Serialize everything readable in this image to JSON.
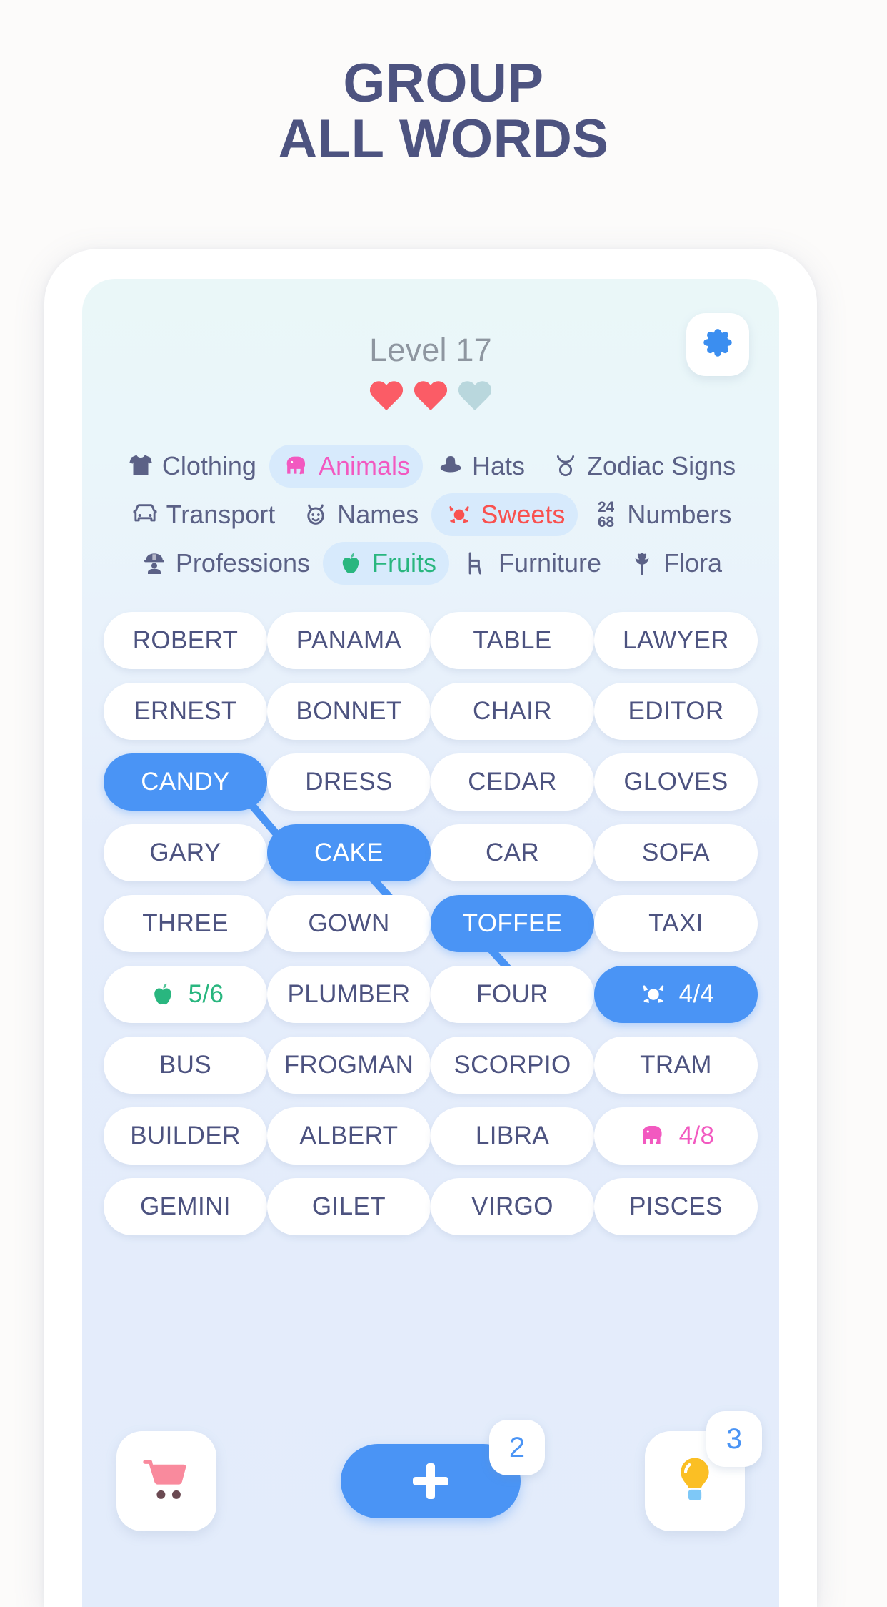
{
  "headline": {
    "line1": "GROUP",
    "line2": "ALL WORDS"
  },
  "header": {
    "level_label": "Level 17",
    "lives_total": 3,
    "lives_remaining": 2,
    "settings_icon": "gear-icon"
  },
  "categories": [
    [
      {
        "label": "Clothing",
        "icon": "tshirt-icon",
        "active": false,
        "color": "#5b6186"
      },
      {
        "label": "Animals",
        "icon": "elephant-icon",
        "active": true,
        "color": "#f259c0"
      },
      {
        "label": "Hats",
        "icon": "hat-icon",
        "active": false,
        "color": "#5b6186"
      },
      {
        "label": "Zodiac Signs",
        "icon": "taurus-icon",
        "active": false,
        "color": "#5b6186"
      }
    ],
    [
      {
        "label": "Transport",
        "icon": "car-icon",
        "active": false,
        "color": "#5b6186"
      },
      {
        "label": "Names",
        "icon": "face-icon",
        "active": false,
        "color": "#5b6186"
      },
      {
        "label": "Sweets",
        "icon": "candy-icon",
        "active": true,
        "color": "#f9514f"
      },
      {
        "label": "Numbers",
        "icon": "numbers-icon",
        "active": false,
        "color": "#5b6186",
        "icon_text_top": "24",
        "icon_text_bottom": "68"
      }
    ],
    [
      {
        "label": "Professions",
        "icon": "worker-icon",
        "active": false,
        "color": "#5b6186"
      },
      {
        "label": "Fruits",
        "icon": "apple-icon",
        "active": true,
        "color": "#29b67f"
      },
      {
        "label": "Furniture",
        "icon": "chair-icon",
        "active": false,
        "color": "#5b6186"
      },
      {
        "label": "Flora",
        "icon": "tulip-icon",
        "active": false,
        "color": "#5b6186"
      }
    ]
  ],
  "grid": [
    [
      {
        "text": "ROBERT"
      },
      {
        "text": "PANAMA"
      },
      {
        "text": "TABLE"
      },
      {
        "text": "LAWYER"
      }
    ],
    [
      {
        "text": "ERNEST"
      },
      {
        "text": "BONNET"
      },
      {
        "text": "CHAIR"
      },
      {
        "text": "EDITOR"
      }
    ],
    [
      {
        "text": "CANDY",
        "selected": true
      },
      {
        "text": "DRESS"
      },
      {
        "text": "CEDAR"
      },
      {
        "text": "GLOVES"
      }
    ],
    [
      {
        "text": "GARY"
      },
      {
        "text": "CAKE",
        "selected": true
      },
      {
        "text": "CAR"
      },
      {
        "text": "SOFA"
      }
    ],
    [
      {
        "text": "THREE"
      },
      {
        "text": "GOWN"
      },
      {
        "text": "TOFFEE",
        "selected": true
      },
      {
        "text": "TAXI"
      }
    ],
    [
      {
        "text": "5/6",
        "counter": true,
        "icon": "apple-icon",
        "tone": "green"
      },
      {
        "text": "PLUMBER"
      },
      {
        "text": "FOUR"
      },
      {
        "text": "4/4",
        "counter": true,
        "icon": "candy-icon",
        "tone": "white",
        "selected": true
      }
    ],
    [
      {
        "text": "BUS"
      },
      {
        "text": "FROGMAN"
      },
      {
        "text": "SCORPIO"
      },
      {
        "text": "TRAM"
      }
    ],
    [
      {
        "text": "BUILDER"
      },
      {
        "text": "ALBERT"
      },
      {
        "text": "LIBRA"
      },
      {
        "text": "4/8",
        "counter": true,
        "icon": "elephant-icon",
        "tone": "pink"
      }
    ],
    [
      {
        "text": "GEMINI"
      },
      {
        "text": "GILET"
      },
      {
        "text": "VIRGO"
      },
      {
        "text": "PISCES"
      }
    ]
  ],
  "bottom_bar": {
    "shop_icon": "shopping-cart-icon",
    "add_icon": "plus-icon",
    "add_badge": "2",
    "hint_icon": "lightbulb-icon",
    "hint_badge": "3"
  },
  "colors": {
    "accent_blue": "#4a94f5",
    "text_dark": "#4d5380",
    "pink": "#f259c0",
    "red": "#f9514f",
    "green": "#29b67f",
    "heart_full": "#fb5c66",
    "heart_empty": "#b9d7dd"
  }
}
